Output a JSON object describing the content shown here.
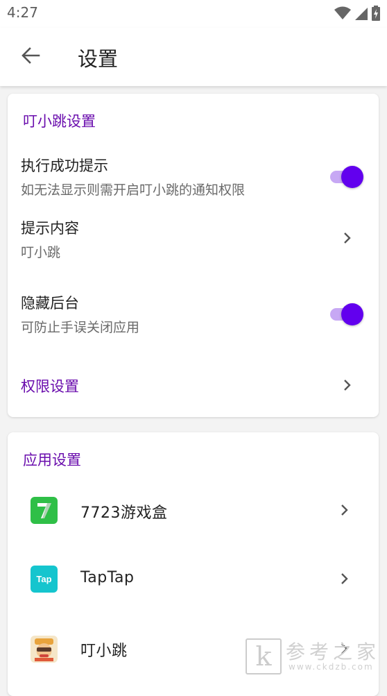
{
  "status_bar": {
    "time": "4:27"
  },
  "app_bar": {
    "title": "设置"
  },
  "section_dingxiaotiao": {
    "title": "叮小跳设置",
    "success_tip": {
      "title": "执行成功提示",
      "subtitle": "如无法显示则需开启叮小跳的通知权限",
      "enabled": true
    },
    "tip_content": {
      "title": "提示内容",
      "value": "叮小跳"
    },
    "hide_background": {
      "title": "隐藏后台",
      "subtitle": "可防止手误关闭应用",
      "enabled": true
    },
    "permission": {
      "label": "权限设置"
    }
  },
  "section_apps": {
    "title": "应用设置",
    "apps": [
      {
        "name": "7723游戏盒"
      },
      {
        "name": "TapTap",
        "icon_text": "Tap"
      },
      {
        "name": "叮小跳"
      }
    ]
  },
  "watermark": {
    "logo": "k",
    "text": "参考之家",
    "url": "www.ckdzb.com"
  },
  "colors": {
    "accent": "#6200ee",
    "section_title": "#6a0dad",
    "track": "#c7a8f4"
  }
}
